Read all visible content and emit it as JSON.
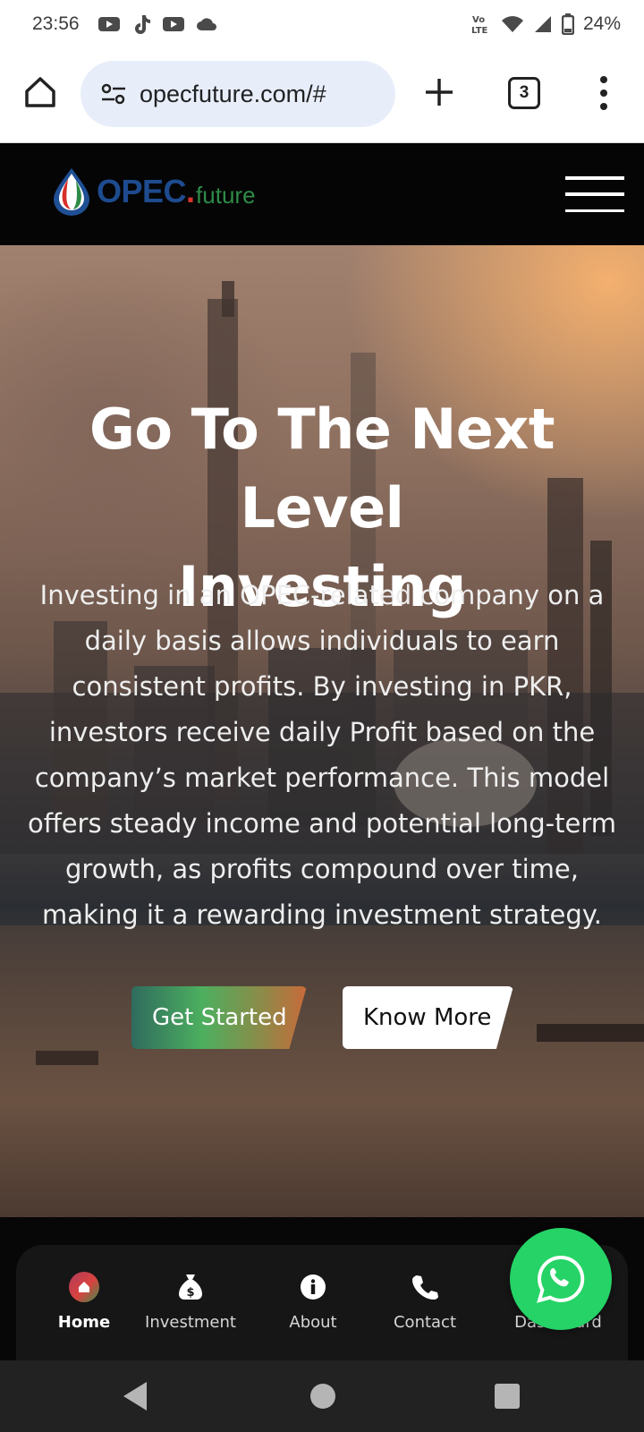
{
  "status_bar": {
    "time": "23:56",
    "network_label": "VoLTE",
    "battery": "24%"
  },
  "browser": {
    "url": "opecfuture.com/#",
    "tab_count": "3"
  },
  "site": {
    "logo_main": "OPEC",
    "logo_dot": ".",
    "logo_sub": "future"
  },
  "hero": {
    "title_line1": "Go To The Next Level",
    "title_line2": "Investing",
    "description": "Investing in an OPEC-related company on a daily basis allows individuals to earn consistent profits. By investing in PKR, investors receive daily Profit based on the company’s market performance. This model offers steady income and potential long-term growth, as profits compound over time, making it a rewarding investment strategy.",
    "primary_button": "Get Started",
    "secondary_button": "Know More"
  },
  "bottom_nav": {
    "items": [
      {
        "label": "Home",
        "icon": "home-icon",
        "active": true
      },
      {
        "label": "Investment",
        "icon": "money-bag-icon",
        "active": false
      },
      {
        "label": "About",
        "icon": "info-icon",
        "active": false
      },
      {
        "label": "Contact",
        "icon": "phone-icon",
        "active": false
      },
      {
        "label": "Dashboard",
        "icon": "dashboard-icon",
        "active": false
      }
    ]
  },
  "floating": {
    "icon": "whatsapp-icon",
    "color": "#25d366"
  },
  "colors": {
    "header_bg": "#050505",
    "logo_blue": "#1e4b8f",
    "logo_green": "#2e8b48",
    "logo_red": "#d8342b"
  }
}
